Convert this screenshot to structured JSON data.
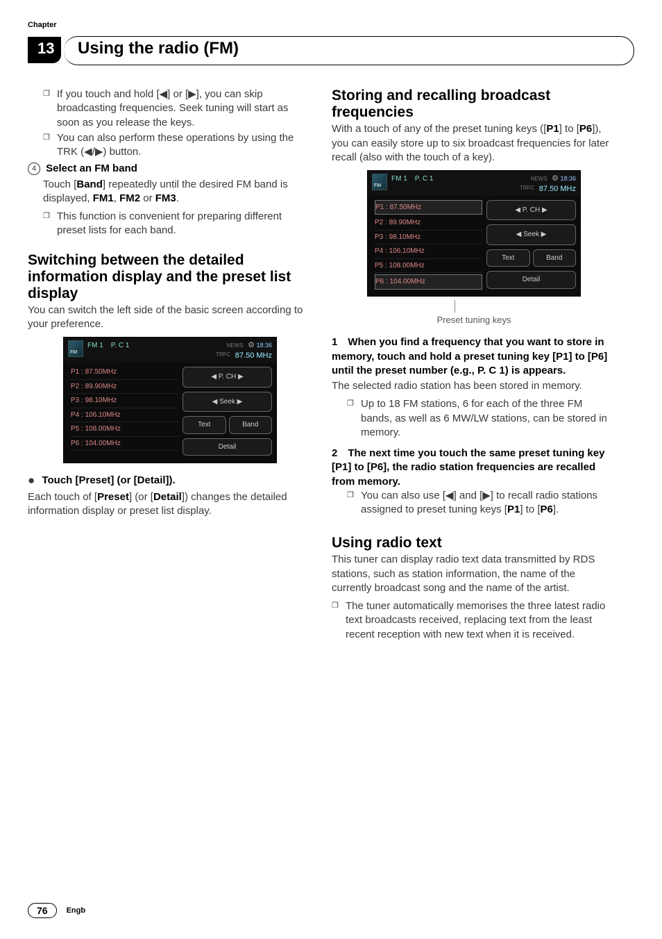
{
  "header": {
    "chapter_label": "Chapter",
    "chapter_number": "13",
    "chapter_title": "Using the radio (FM)"
  },
  "left": {
    "bullets1": [
      "If you touch and hold [◀] or [▶], you can skip broadcasting frequencies. Seek tuning will start as soon as you release the keys.",
      "You can also perform these operations by using the TRK (◀/▶) button."
    ],
    "step4_num": "4",
    "step4_title": "Select an FM band",
    "step4_body_a": "Touch [",
    "step4_band": "Band",
    "step4_body_b": "] repeatedly until the desired FM band is displayed, ",
    "step4_fm1": "FM1",
    "step4_fm2": "FM2",
    "step4_or": " or ",
    "step4_fm3": "FM3",
    "step4_body_c": ".",
    "step4_bullet": "This function is convenient for preparing different preset lists for each band.",
    "h2_switch": "Switching between the detailed information display and the preset list display",
    "switch_body": "You can switch the left side of the basic screen according to your preference.",
    "touch_preset_label": "Touch [Preset] (or [Detail]).",
    "touch_preset_body_a": "Each touch of [",
    "preset_word": "Preset",
    "touch_preset_body_b": "] (or [",
    "detail_word": "Detail",
    "touch_preset_body_c": "]) changes the detailed information display or preset list display."
  },
  "right": {
    "h2_store": "Storing and recalling broadcast frequencies",
    "store_body_a": "With a touch of any of the preset tuning keys ([",
    "p1": "P1",
    "store_body_b": "] to [",
    "p6": "P6",
    "store_body_c": "]), you can easily store up to six broadcast frequencies for later recall (also with the touch of a key).",
    "caption": "Preset tuning keys",
    "step1": "1 When you find a frequency that you want to store in memory, touch and hold a preset tuning key [P1] to [P6] until the preset number (e.g., P. C 1) is appears.",
    "step1_body": "The selected radio station has been stored in memory.",
    "step1_bullet": "Up to 18 FM stations, 6 for each of the three FM bands, as well as 6 MW/LW stations, can be stored in memory.",
    "step2": "2 The next time you touch the same preset tuning key [P1] to [P6], the radio station frequencies are recalled from memory.",
    "step2_bullet_a": "You can also use [◀] and [▶] to recall radio stations assigned to preset tuning keys [",
    "step2_bullet_b": "] to [",
    "step2_bullet_c": "].",
    "h2_radiotext": "Using radio text",
    "radiotext_body": "This tuner can display radio text data transmitted by RDS stations, such as station information, the name of the currently broadcast song and the name of the artist.",
    "radiotext_bullet": "The tuner automatically memorises the three latest radio text broadcasts received, replacing text from the least recent reception with new text when it is received."
  },
  "screenshot": {
    "top_band": "FM  1",
    "top_pc": "P. C  1",
    "news": "NEWS",
    "trfc": "TRFC",
    "time": "18:36",
    "freq": "87.50 MHz",
    "presets": [
      "P1 : 87.50MHz",
      "P2 : 89.90MHz",
      "P3 : 98.10MHz",
      "P4 : 106.10MHz",
      "P5 : 108.00MHz",
      "P6 : 104.00MHz"
    ],
    "btn_pch": "◀  P. CH  ▶",
    "btn_seek": "◀  Seek  ▶",
    "btn_text": "Text",
    "btn_band": "Band",
    "btn_detail": "Detail"
  },
  "footer": {
    "page": "76",
    "lang": "Engb"
  }
}
